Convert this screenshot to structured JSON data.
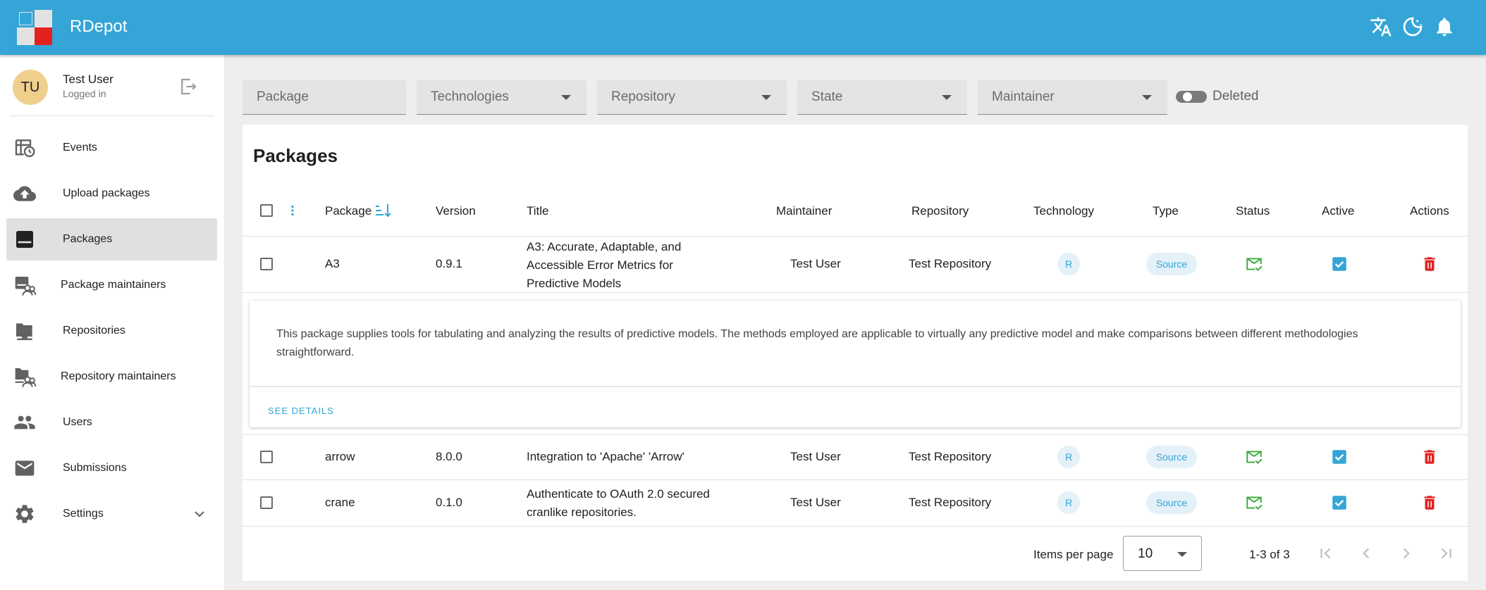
{
  "app": {
    "title": "RDepot",
    "colors": {
      "primary": "#34a5d6",
      "logo_red": "#e3211f",
      "logo_blue": "#34a5d6",
      "logo_gray": "#e2e2e2",
      "success": "#3daa3d",
      "danger": "#e3211f"
    },
    "top_icons": [
      "translate-icon",
      "dark-mode-icon",
      "notifications-icon"
    ]
  },
  "user": {
    "initials": "TU",
    "name": "Test User",
    "status": "Logged in"
  },
  "nav": [
    {
      "label": "Events",
      "icon": "events-icon"
    },
    {
      "label": "Upload packages",
      "icon": "cloud-upload-icon"
    },
    {
      "label": "Packages",
      "icon": "package-icon",
      "active": true
    },
    {
      "label": "Package maintainers",
      "icon": "package-maintainers-icon"
    },
    {
      "label": "Repositories",
      "icon": "folder-icon"
    },
    {
      "label": "Repository maintainers",
      "icon": "repository-maintainers-icon"
    },
    {
      "label": "Users",
      "icon": "users-icon"
    },
    {
      "label": "Submissions",
      "icon": "mail-icon"
    },
    {
      "label": "Settings",
      "icon": "settings-icon"
    }
  ],
  "filters": {
    "package": "Package",
    "technologies": "Technologies",
    "repository": "Repository",
    "state": "State",
    "maintainer": "Maintainer",
    "deleted": "Deleted"
  },
  "table": {
    "title": "Packages",
    "columns": [
      "Package",
      "Version",
      "Title",
      "Maintainer",
      "Repository",
      "Technology",
      "Type",
      "Status",
      "Active",
      "Actions"
    ],
    "rows": [
      {
        "package": "A3",
        "version": "0.9.1",
        "title": "A3: Accurate, Adaptable, and Accessible Error Metrics for Predictive Models",
        "maintainer": "Test User",
        "repository": "Test Repository",
        "technology": "R",
        "type": "Source"
      },
      {
        "package": "arrow",
        "version": "8.0.0",
        "title": "Integration to 'Apache' 'Arrow'",
        "maintainer": "Test User",
        "repository": "Test Repository",
        "technology": "R",
        "type": "Source"
      },
      {
        "package": "crane",
        "version": "0.1.0",
        "title": "Authenticate to OAuth 2.0 secured cranlike repositories.",
        "maintainer": "Test User",
        "repository": "Test Repository",
        "technology": "R",
        "type": "Source"
      }
    ],
    "expanded": {
      "description": "This package supplies tools for tabulating and analyzing the results of predictive models. The methods employed are applicable to virtually any predictive model and make comparisons between different methodologies straightforward.",
      "see_details": "SEE DETAILS"
    }
  },
  "pagination": {
    "items_per_page_label": "Items per page",
    "items_per_page": "10",
    "range": "1-3 of 3"
  }
}
